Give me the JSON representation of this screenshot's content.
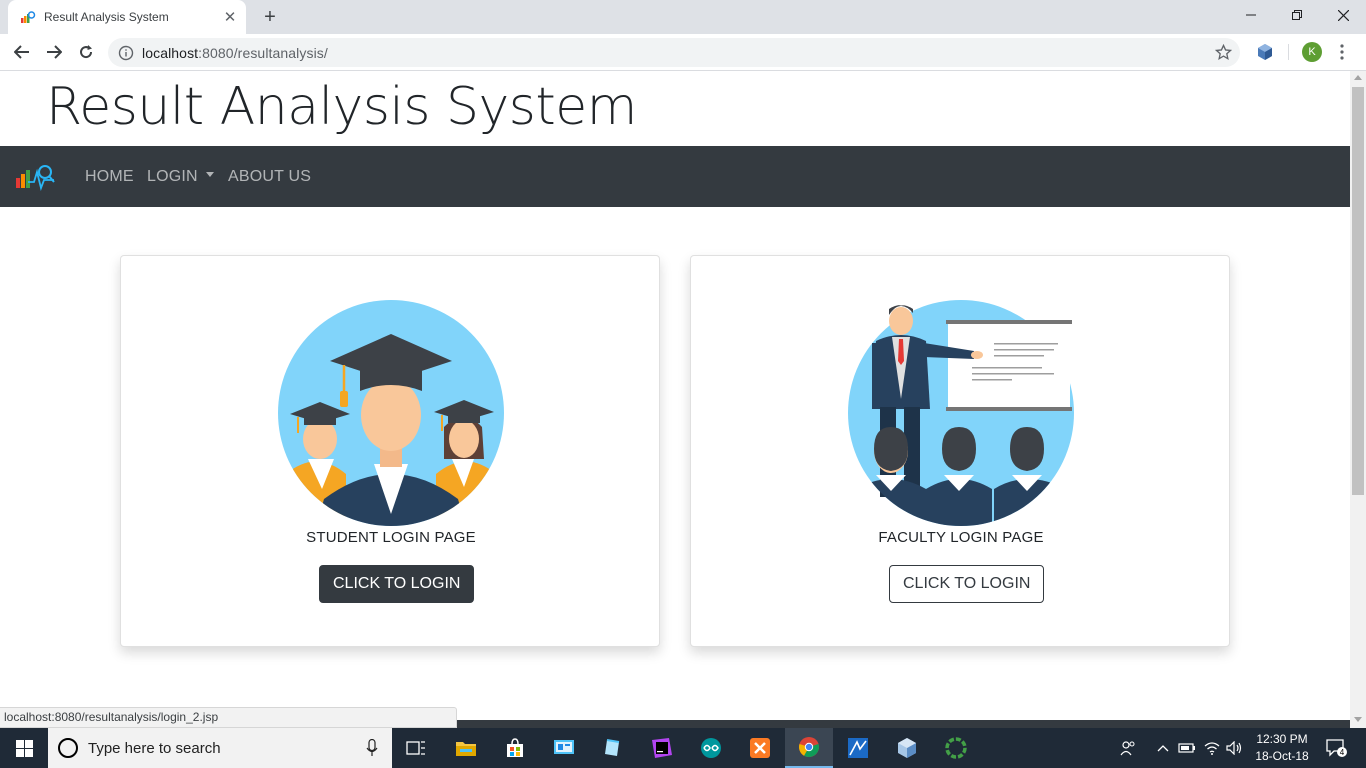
{
  "browser": {
    "tab_title": "Result Analysis System",
    "tab_close": "✕",
    "new_tab": "+",
    "url_host": "localhost",
    "url_rest": ":8080/resultanalysis/",
    "avatar_initial": "K",
    "status_url": "localhost:8080/resultanalysis/login_2.jsp"
  },
  "site": {
    "title": "Result Analysis System",
    "nav": {
      "home": "HOME",
      "login": "LOGIN",
      "about": "ABOUT US"
    }
  },
  "cards": {
    "student": {
      "label": "STUDENT LOGIN PAGE",
      "button": "CLICK TO LOGIN",
      "illustration_icon": "graduates-icon"
    },
    "faculty": {
      "label": "FACULTY LOGIN PAGE",
      "button": "CLICK TO LOGIN",
      "illustration_icon": "presenter-icon"
    }
  },
  "taskbar": {
    "search_placeholder": "Type here to search",
    "time": "12:30 PM",
    "date": "18-Oct-18",
    "notification_count": "4",
    "apps": [
      "task-view-icon",
      "file-explorer-icon",
      "store-icon",
      "control-panel-icon",
      "notepad-icon",
      "phpstorm-icon",
      "arduino-icon",
      "xampp-icon",
      "chrome-icon",
      "netbeans-icon",
      "virtualbox-icon",
      "app-ring-icon"
    ]
  },
  "colors": {
    "navbar": "#343a40",
    "illustration_bg": "#81d4fa",
    "taskbar": "#1f2a37"
  }
}
